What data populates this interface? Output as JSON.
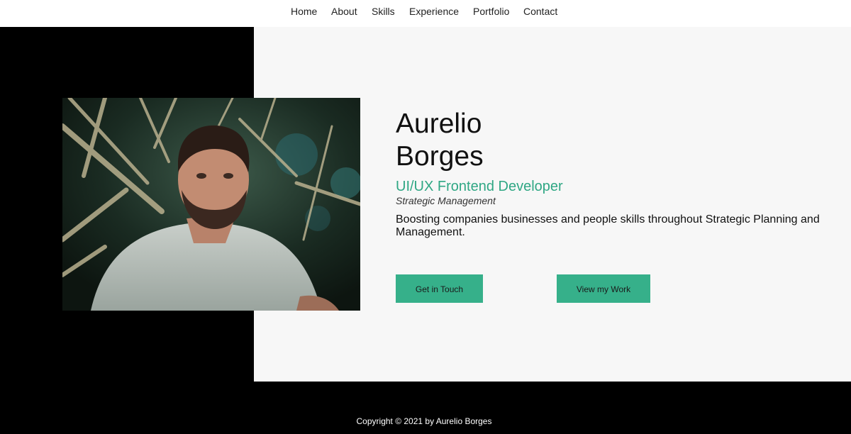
{
  "nav": {
    "items": [
      {
        "label": "Home"
      },
      {
        "label": "About"
      },
      {
        "label": "Skills"
      },
      {
        "label": "Experience"
      },
      {
        "label": "Portfolio"
      },
      {
        "label": "Contact"
      }
    ]
  },
  "hero": {
    "first_name": "Aurelio",
    "last_name": "Borges",
    "role": "UI/UX Frontend Developer",
    "subtitle": "Strategic Management",
    "description": "Boosting companies businesses and people skills throughout Strategic Planning and Management.",
    "buttons": {
      "primary": "Get in Touch",
      "secondary": "View my Work"
    }
  },
  "footer": {
    "copyright": "Copyright © 2021 by Aurelio Borges"
  },
  "colors": {
    "accent": "#36b08a",
    "accent_text": "#2fa784",
    "panel": "#f7f7f7",
    "background": "#000000"
  }
}
